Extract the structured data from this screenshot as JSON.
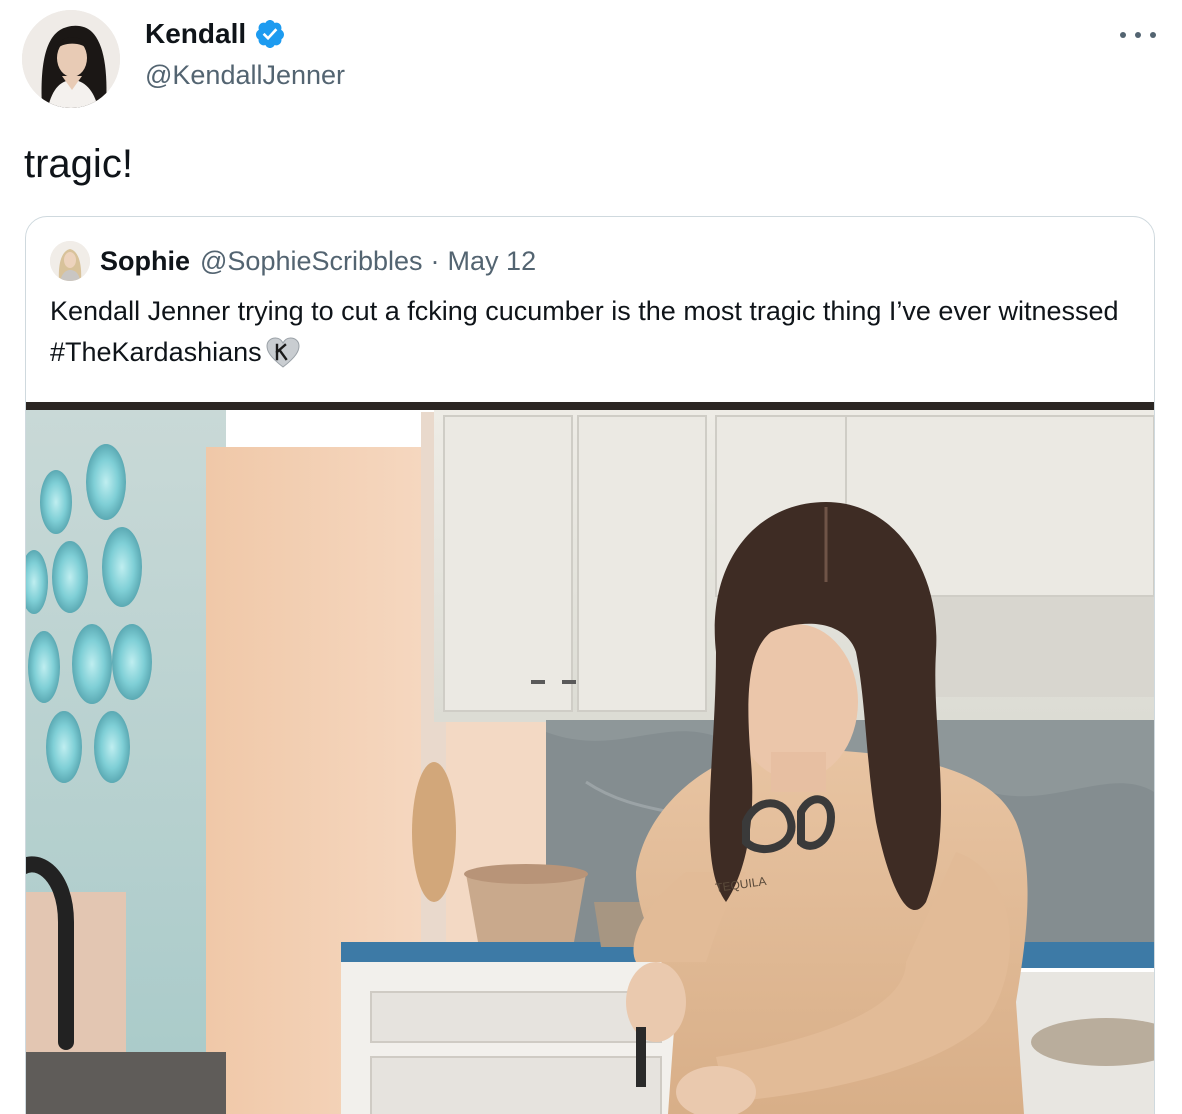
{
  "author": {
    "name": "Kendall",
    "handle": "@KendallJenner",
    "verified": true
  },
  "tweet": {
    "text": "tragic!"
  },
  "quoted_tweet": {
    "name": "Sophie",
    "handle": "@SophieScribbles",
    "separator": "·",
    "date": "May 12",
    "text_main": "Kendall Jenner trying to cut a fcking cucumber is the most tragic thing I’ve ever witnessed ",
    "hashtag": "#TheKardashians",
    "emoji_icon": "k-heart-icon"
  },
  "media": {
    "sweatshirt_print": "TEQUILA"
  },
  "colors": {
    "text": "#0f1419",
    "secondary_text": "#536471",
    "verified_blue": "#1d9bf0",
    "border": "#cfd9de"
  }
}
